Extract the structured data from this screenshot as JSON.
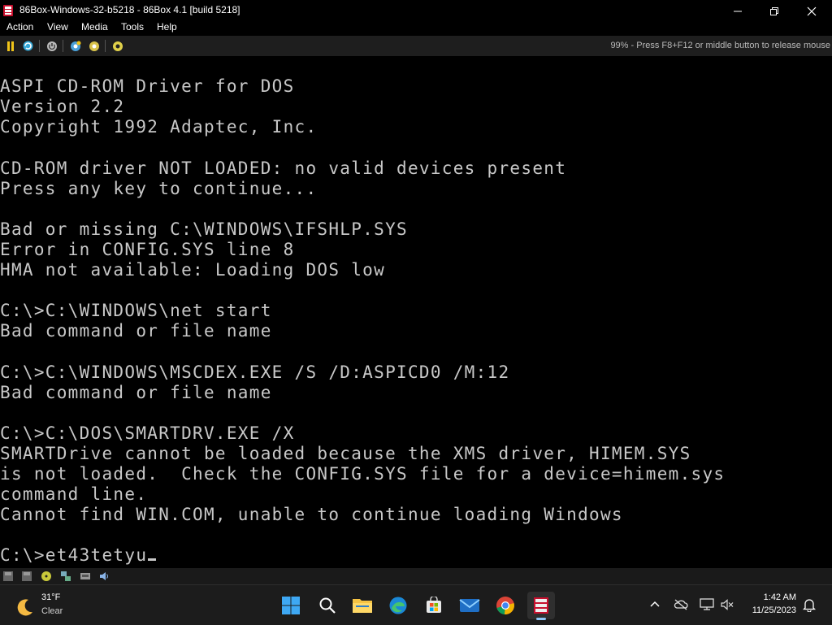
{
  "window": {
    "title": "86Box-Windows-32-b5218 - 86Box 4.1 [build 5218]"
  },
  "menu": {
    "items": [
      "Action",
      "View",
      "Media",
      "Tools",
      "Help"
    ]
  },
  "toolbar": {
    "status_message": "99% - Press F8+F12 or middle button to release mouse"
  },
  "dos": {
    "lines": [
      "",
      "ASPI CD-ROM Driver for DOS",
      "Version 2.2",
      "Copyright 1992 Adaptec, Inc.",
      "",
      "CD-ROM driver NOT LOADED: no valid devices present",
      "Press any key to continue...",
      "",
      "Bad or missing C:\\WINDOWS\\IFSHLP.SYS",
      "Error in CONFIG.SYS line 8",
      "HMA not available: Loading DOS low",
      "",
      "C:\\>C:\\WINDOWS\\net start",
      "Bad command or file name",
      "",
      "C:\\>C:\\WINDOWS\\MSCDEX.EXE /S /D:ASPICD0 /M:12",
      "Bad command or file name",
      "",
      "C:\\>C:\\DOS\\SMARTDRV.EXE /X",
      "SMARTDrive cannot be loaded because the XMS driver, HIMEM.SYS",
      "is not loaded.  Check the CONFIG.SYS file for a device=himem.sys",
      "command line.",
      "Cannot find WIN.COM, unable to continue loading Windows",
      "",
      "C:\\>et43tetyu"
    ]
  },
  "taskbar": {
    "weather_temp": "31°F",
    "weather_condition": "Clear",
    "clock_time": "1:42 AM",
    "clock_date": "11/25/2023"
  },
  "colors": {
    "dos_text": "#c8c8c8",
    "dos_background": "#000000",
    "taskbar": "#1c1c1c"
  }
}
